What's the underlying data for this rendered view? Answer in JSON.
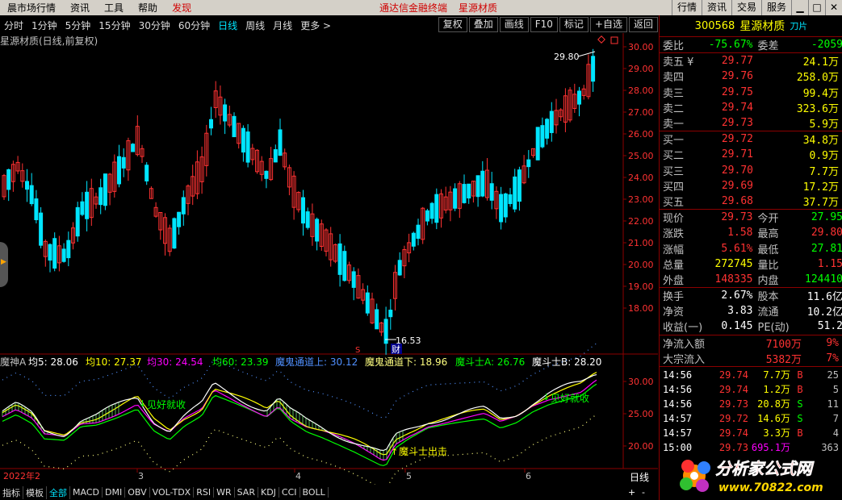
{
  "menu": {
    "items": [
      "晨市场行情",
      "资讯",
      "工具",
      "帮助"
    ],
    "active": "发现",
    "center": [
      "通达信金融终端",
      "星源材质"
    ],
    "right": [
      "行情",
      "资讯",
      "交易",
      "服务"
    ]
  },
  "toolbar": {
    "periods": [
      "分时",
      "1分钟",
      "5分钟",
      "15分钟",
      "30分钟",
      "60分钟",
      "日线",
      "周线",
      "月线",
      "更多 >"
    ],
    "selected": "日线",
    "buttons": [
      "复权",
      "叠加",
      "画线",
      "F10",
      "标记",
      "+自选",
      "返回"
    ]
  },
  "chart": {
    "title": "星源材质(日线,前复权)",
    "high_label": "29.80",
    "low_label": "16.53",
    "price_ticks": [
      "30.00",
      "29.00",
      "28.00",
      "27.00",
      "26.00",
      "25.00",
      "24.00",
      "23.00",
      "22.00",
      "21.00",
      "20.00",
      "19.00",
      "18.00"
    ],
    "indicator_title": "魔神A",
    "ma5": "均5: 28.06",
    "ma10": "均10: 27.37",
    "ma30": "均30: 24.54",
    "ma60": "均60: 23.39",
    "ch_up": "魔鬼通道上: 30.12",
    "ch_dn": "魔鬼通道下: 18.96",
    "msa": "魔斗士A: 26.76",
    "msb": "魔斗士B: 28.20",
    "ind_ticks": [
      "30.00",
      "25.00",
      "20.00"
    ],
    "ann_buy1": "见好就收",
    "ann_buy2": "见好就收",
    "ann_fighter": "魔斗士出击",
    "cai": "财",
    "s_mark": "S",
    "dates": [
      "2022年2",
      "3",
      "4",
      "5",
      "6"
    ],
    "period_label": "日线",
    "plusminus": [
      "+",
      "-"
    ],
    "colors": {
      "up": "#ff3232",
      "down": "#00e5ff",
      "ma5": "#ffffff",
      "ma10": "#ffff00",
      "ma30": "#ff00ff",
      "ma60": "#00ff00"
    }
  },
  "quote": {
    "code": "300568",
    "name": "星源材质",
    "badge": "刀片",
    "weibi": [
      "委比",
      "-75.67%",
      "委差",
      "-2059"
    ],
    "sells": [
      [
        "卖五 ¥",
        "29.77",
        "24.1万"
      ],
      [
        "卖四",
        "29.76",
        "258.0万"
      ],
      [
        "卖三",
        "29.75",
        "99.4万"
      ],
      [
        "卖二",
        "29.74",
        "323.6万"
      ],
      [
        "卖一",
        "29.73",
        "5.9万"
      ]
    ],
    "buys": [
      [
        "买一",
        "29.72",
        "34.8万"
      ],
      [
        "买二",
        "29.71",
        "0.9万"
      ],
      [
        "买三",
        "29.70",
        "7.7万"
      ],
      [
        "买四",
        "29.69",
        "17.2万"
      ],
      [
        "买五",
        "29.68",
        "37.7万"
      ]
    ],
    "stats": [
      [
        "现价",
        "29.73",
        "今开",
        "27.95"
      ],
      [
        "涨跌",
        "1.58",
        "最高",
        "29.80"
      ],
      [
        "涨幅",
        "5.61%",
        "最低",
        "27.81"
      ],
      [
        "总量",
        "272745",
        "量比",
        "1.15"
      ],
      [
        "外盘",
        "148335",
        "内盘",
        "124410"
      ]
    ],
    "stats2": [
      [
        "换手",
        "2.67%",
        "股本",
        "11.6亿"
      ],
      [
        "净资",
        "3.83",
        "流通",
        "10.2亿"
      ],
      [
        "收益(一)",
        "0.145",
        "PE(动)",
        "51.2"
      ]
    ],
    "flows": [
      [
        "净流入额",
        "7100万",
        "9%"
      ],
      [
        "大宗流入",
        "5382万",
        "7%"
      ]
    ],
    "ticks": [
      [
        "14:56",
        "29.74",
        "7.7万",
        "B",
        "25"
      ],
      [
        "14:56",
        "29.74",
        "1.2万",
        "B",
        "5"
      ],
      [
        "14:56",
        "29.73",
        "20.8万",
        "S",
        "11"
      ],
      [
        "14:57",
        "29.72",
        "14.6万",
        "S",
        "7"
      ],
      [
        "14:57",
        "29.74",
        "3.3万",
        "B",
        "4"
      ],
      [
        "15:00",
        "29.73",
        "695.1万",
        "",
        "363"
      ]
    ]
  },
  "bottom": {
    "tabs": [
      "指标",
      "模板",
      "全部",
      "MACD",
      "DMI",
      "OBV",
      "VOL-TDX",
      "RSI",
      "WR",
      "SAR",
      "KDJ",
      "CCI",
      "BOLL"
    ],
    "selected": "全部"
  },
  "logo": {
    "main": "分析家公式网",
    "url": "www.70822.com"
  }
}
